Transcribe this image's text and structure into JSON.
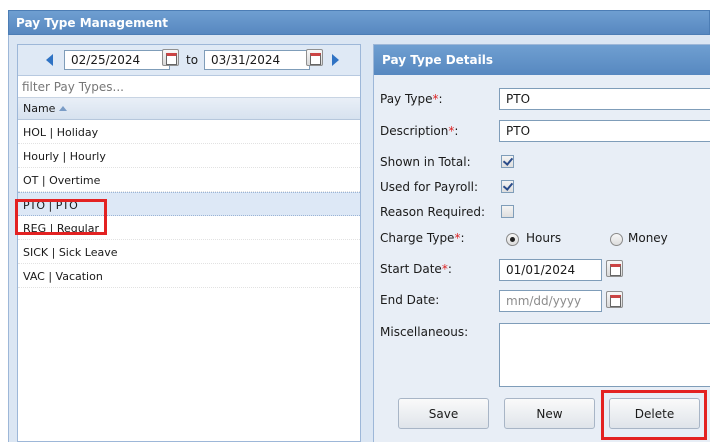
{
  "app": {
    "title": "Pay Type Management"
  },
  "date_range": {
    "from": "02/25/2024",
    "to_label": "to",
    "to": "03/31/2024"
  },
  "filter": {
    "placeholder": "filter Pay Types..."
  },
  "list": {
    "column_header": "Name",
    "items": [
      {
        "label": "HOL | Holiday"
      },
      {
        "label": "Hourly | Hourly"
      },
      {
        "label": "OT | Overtime"
      },
      {
        "label": "PTO | PTO",
        "selected": true
      },
      {
        "label": "REG | Regular"
      },
      {
        "label": "SICK | Sick Leave"
      },
      {
        "label": "VAC | Vacation"
      }
    ]
  },
  "details": {
    "title": "Pay Type Details",
    "pay_type_label": "Pay Type",
    "pay_type_value": "PTO",
    "description_label": "Description",
    "description_value": "PTO",
    "shown_in_total_label": "Shown in Total:",
    "shown_in_total": true,
    "used_for_payroll_label": "Used for Payroll:",
    "used_for_payroll": true,
    "reason_required_label": "Reason Required:",
    "reason_required": false,
    "charge_type_label": "Charge Type",
    "charge_type_options": [
      "Hours",
      "Money"
    ],
    "charge_type_selected": "Hours",
    "start_date_label": "Start Date",
    "start_date_value": "01/01/2024",
    "end_date_label": "End Date:",
    "end_date_placeholder": "mm/dd/yyyy",
    "misc_label": "Miscellaneous:",
    "misc_value": "",
    "required_mark": "*",
    "colon": ":"
  },
  "buttons": {
    "save": "Save",
    "new": "New",
    "delete": "Delete"
  },
  "colors": {
    "header_blue": "#5f8fc8",
    "highlight_red": "#e32222",
    "required_red": "#d22222"
  }
}
